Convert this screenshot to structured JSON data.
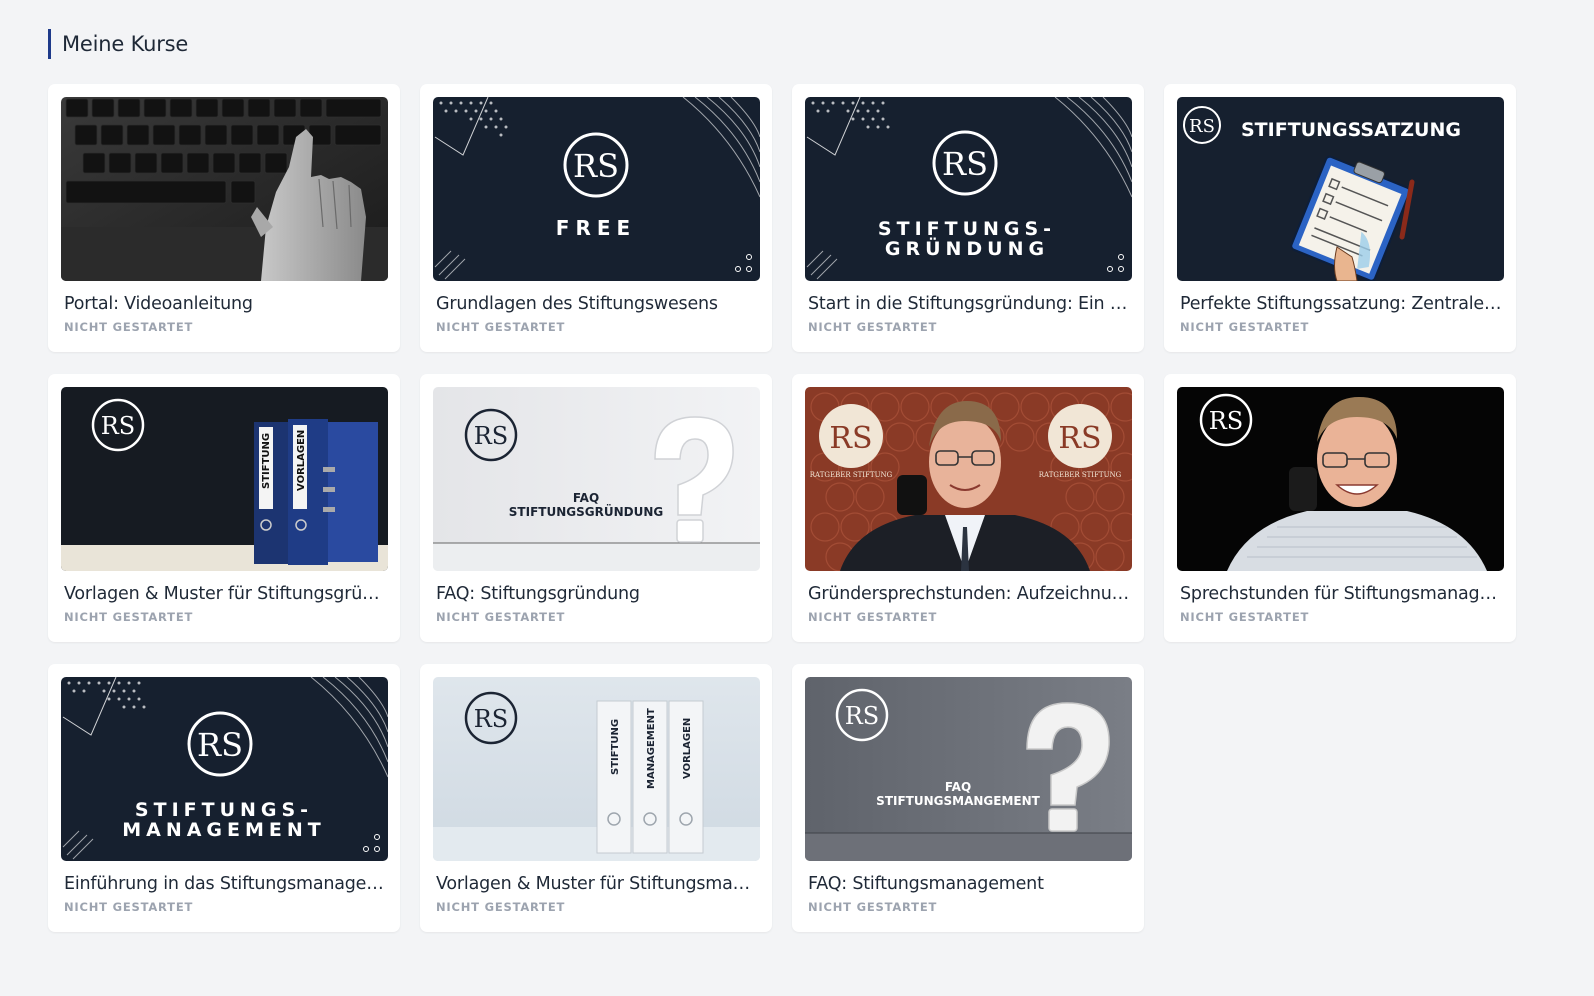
{
  "page": {
    "title": "Meine Kurse"
  },
  "courses": [
    {
      "title": "Portal: Videoanleitung",
      "status": "NICHT GESTARTET",
      "thumb_text": []
    },
    {
      "title": "Grundlagen des Stiftungswesens",
      "status": "NICHT GESTARTET",
      "thumb_text": [
        "RS",
        "FREE"
      ]
    },
    {
      "title": "Start in die Stiftungsgründung: Ein Leit...",
      "status": "NICHT GESTARTET",
      "thumb_text": [
        "RS",
        "STIFTUNGS-",
        "GRÜNDUNG"
      ]
    },
    {
      "title": "Perfekte Stiftungssatzung: Zentrale Fr...",
      "status": "NICHT GESTARTET",
      "thumb_text": [
        "RS",
        "STIFTUNGSSATZUNG"
      ]
    },
    {
      "title": "Vorlagen & Muster für Stiftungsgründu...",
      "status": "NICHT GESTARTET",
      "thumb_text": [
        "RS",
        "STIFTUNG",
        "VORLAGEN"
      ]
    },
    {
      "title": "FAQ: Stiftungsgründung",
      "status": "NICHT GESTARTET",
      "thumb_text": [
        "RS",
        "FAQ",
        "STIFTUNGSGRÜNDUNG"
      ]
    },
    {
      "title": "Gründersprechstunden: Aufzeichnungen",
      "status": "NICHT GESTARTET",
      "thumb_text": [
        "RS",
        "RATGEBER STIFTUNG",
        "RS",
        "RATGEBER STIFTUNG"
      ]
    },
    {
      "title": "Sprechstunden für Stiftungsmanagem...",
      "status": "NICHT GESTARTET",
      "thumb_text": [
        "RS"
      ]
    },
    {
      "title": "Einführung in das Stiftungsmanagement",
      "status": "NICHT GESTARTET",
      "thumb_text": [
        "RS",
        "STIFTUNGS-",
        "MANAGEMENT"
      ]
    },
    {
      "title": "Vorlagen & Muster für Stiftungsmanag...",
      "status": "NICHT GESTARTET",
      "thumb_text": [
        "RS",
        "STIFTUNG",
        "MANAGEMENT",
        "VORLAGEN"
      ]
    },
    {
      "title": "FAQ: Stiftungsmanagement",
      "status": "NICHT GESTARTET",
      "thumb_text": [
        "RS",
        "FAQ",
        "STIFTUNGSMANGEMENT"
      ]
    }
  ],
  "colors": {
    "accent": "#1e3a8a",
    "navy": "#16202f",
    "status": "#9ca3af",
    "background": "#f3f4f6"
  }
}
